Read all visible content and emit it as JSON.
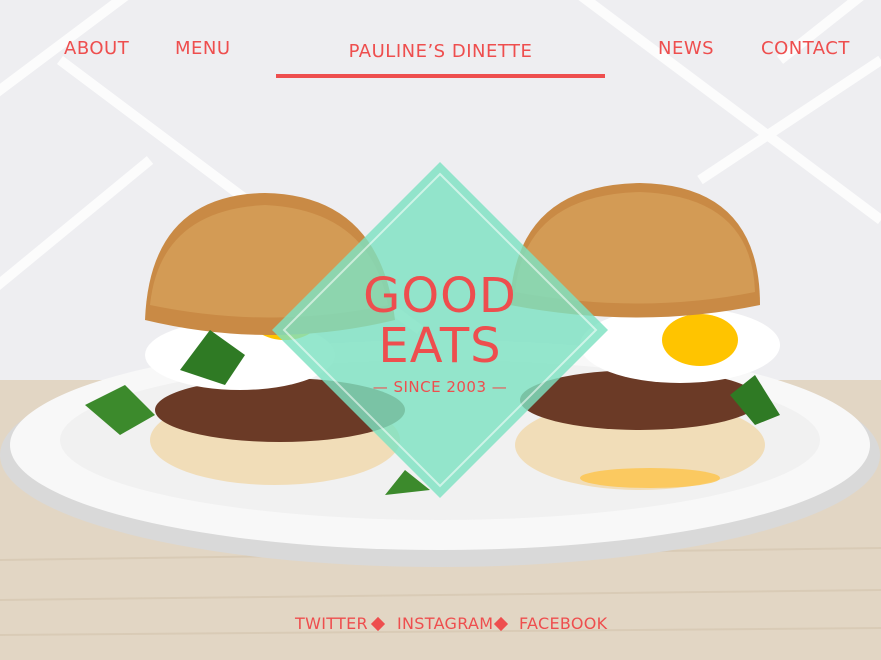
{
  "nav": {
    "about": "ABOUT",
    "menu": "MENU",
    "brand": "PAULINE’S DINETTE",
    "news": "NEWS",
    "contact": "CONTACT"
  },
  "hero": {
    "line1": "GOOD",
    "line2": "EATS",
    "since": "— SINCE 2003 —"
  },
  "footer": {
    "twitter": "TWITTER",
    "instagram": "INSTAGRAM",
    "facebook": "FACEBOOK"
  },
  "colors": {
    "accent": "#ee4e4e",
    "badge_fill": "#7ee2c2"
  }
}
